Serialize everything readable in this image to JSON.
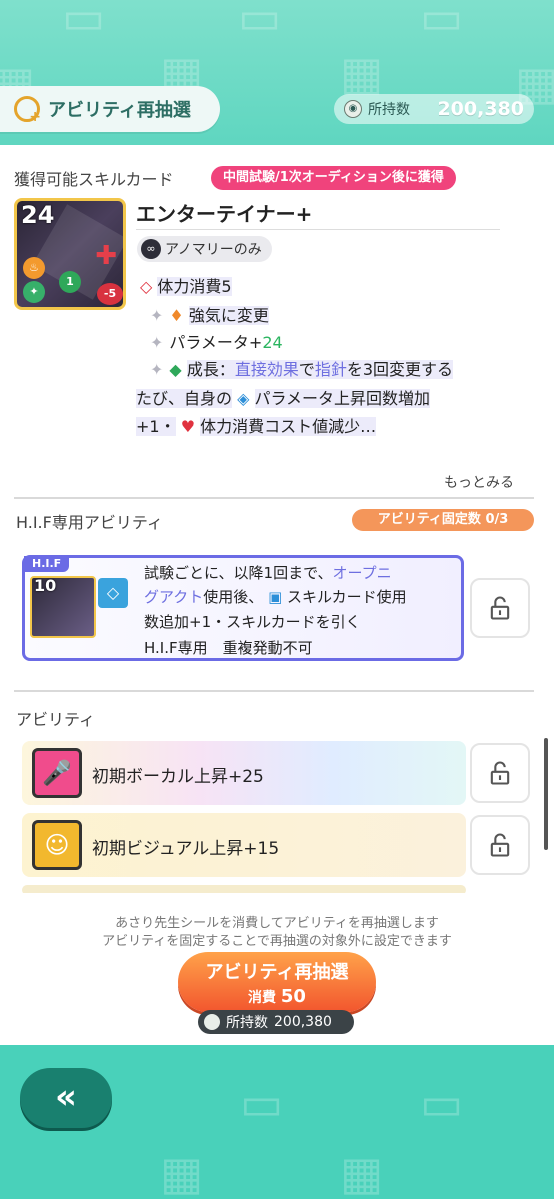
{
  "header": {
    "reroll_label": "アビリティ再抽選",
    "owned_label": "所持数",
    "owned_value": "200,380"
  },
  "skill_section": {
    "title": "獲得可能スキルカード",
    "badge": "中間試験/1次オーディション後に獲得",
    "card": {
      "cost": "24",
      "green_gem": "1",
      "red_gem": "-5",
      "name": "エンターテイナー+",
      "anomaly_label": "アノマリーのみ"
    },
    "desc": {
      "line1": "体力消費5",
      "line2": "強気に変更",
      "line3_a": "パラメータ+",
      "line3_b": "24",
      "line4_a": "成長：",
      "line4_b": "直接効果",
      "line4_c": "で",
      "line4_d": "指針",
      "line4_e": "を3回変更する",
      "line5_a": "たび、自身の",
      "line5_b": "パラメータ上昇回数増加",
      "line6_a": "+1・",
      "line6_b": "体力消費コスト値減少…"
    },
    "more": "もっとみる"
  },
  "hif_section": {
    "title": "H.I.F専用アビリティ",
    "badge": "アビリティ固定数 0/3",
    "tag": "H.I.F",
    "thumb_cost": "10",
    "text1_a": "試験ごとに、以降1回まで、",
    "text1_b": "オープニ",
    "text2_a": "グアクト",
    "text2_b": "使用後、",
    "text2_c": "スキルカード使用",
    "text3": "数追加+1・スキルカードを引く",
    "text4": "H.I.F専用　重複発動不可"
  },
  "ability_section": {
    "title": "アビリティ",
    "items": [
      {
        "label": "初期ボーカル上昇+25",
        "icon": "microphone-icon"
      },
      {
        "label": "初期ビジュアル上昇+15",
        "icon": "visual-icon"
      }
    ]
  },
  "footer": {
    "note1": "あさり先生シールを消費してアビリティを再抽選します",
    "note2": "アビリティを固定することで再抽選の対象外に設定できます",
    "button_label": "アビリティ再抽選",
    "cost_label": "消費",
    "cost_value": "50",
    "owned_label": "所持数",
    "owned_value": "200,380"
  },
  "nav": {
    "back_label": "«"
  },
  "colors": {
    "teal": "#4fd4bd",
    "pink_badge": "#f0437c",
    "orange_badge": "#f4965a",
    "hif_border": "#6b6be5",
    "button_orange": "#f2562e"
  }
}
